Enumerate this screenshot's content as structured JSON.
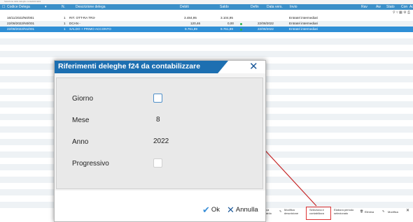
{
  "window": {
    "caption": "Selezione delle deleghe contabilizzabili"
  },
  "table": {
    "headers": {
      "codice": "Codice Delega",
      "n": "N.",
      "descrizione": "Descrizione delega",
      "debiti": "Debiti",
      "saldo": "Saldo",
      "defin": "Defin",
      "data_vers": "Data vers.",
      "invio": "Invio",
      "rav": "Rav",
      "aw": "Aw",
      "stato": "Stato",
      "con": "Con",
      "ac": "Ac"
    },
    "rows": [
      {
        "codice": "16/11/2022/N0/001",
        "n": "1",
        "descrizione": "RIT. OTT-RA TR3-",
        "debiti": "3.484,95",
        "saldo": "3.104,95",
        "data_vers": "",
        "invio": "Entratel intermediari"
      },
      {
        "codice": "22/08/2022/N0/001",
        "n": "1",
        "descrizione": "DCAN -",
        "debiti": "120,46",
        "saldo": "0,00",
        "data_vers": "22/08/2022",
        "invio": "Entratel intermediari"
      },
      {
        "codice": "22/08/2022/N1/001",
        "n": "1",
        "descrizione": "SALDO + PRIMO ACCONTO",
        "debiti": "9.761,89",
        "saldo": "9.761,89",
        "data_vers": "22/08/2022",
        "invio": "Entratel intermediari"
      }
    ]
  },
  "dialog": {
    "title": "Riferimenti deleghe f24 da contabilizzare",
    "fields": {
      "giorno": {
        "label": "Giorno"
      },
      "mese": {
        "label": "Mese",
        "value": "8"
      },
      "anno": {
        "label": "Anno",
        "value": "2022"
      },
      "progressivo": {
        "label": "Progressivo"
      }
    },
    "ok_label": "Ok",
    "cancel_label": "Annulla"
  },
  "toolbar": {
    "partial_left": "ca\nardo",
    "modifica_descrizione": "Modifica\ndescrizione",
    "seleziona_contabilizza": "Seleziona e\ncontabilizza",
    "elabora_periodo": "Elabora periodo\nselezionato",
    "elimina": "Elimina",
    "modifica": "Modifica"
  },
  "colors": {
    "accent": "#1d6fb1",
    "selected_row": "#2f8fd6",
    "highlight": "#dd3333",
    "ok_icon": "#3a8fd8"
  }
}
